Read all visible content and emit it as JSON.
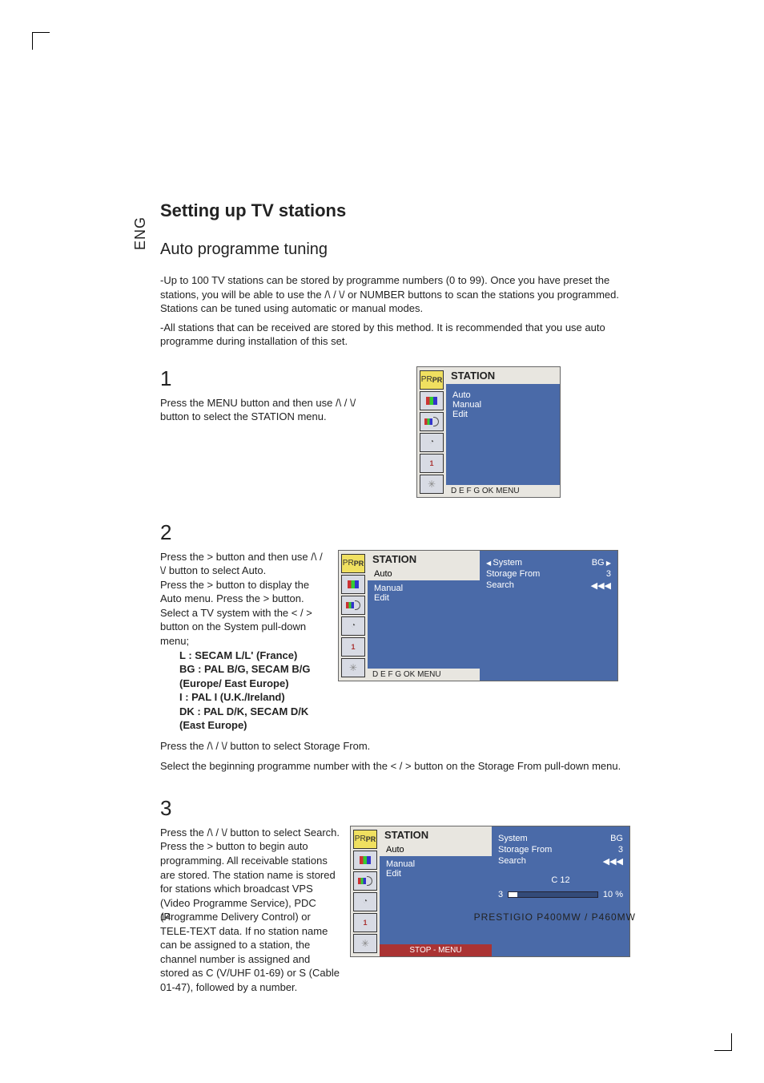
{
  "side_tab": "ENG",
  "title": "Setting up TV stations",
  "subtitle": "Auto programme tuning",
  "intro_line1": "-Up to 100 TV stations can be stored by programme numbers (0 to 99). Once you have preset the stations, you will be able to use the /\\ / \\/ or NUMBER buttons to scan the stations you programmed. Stations can be tuned using automatic or manual modes.",
  "intro_line2": "-All stations that can be received are stored by this method. It is recommended that you use auto programme during installation of this set.",
  "step1": {
    "num": "1",
    "text": "Press the MENU button and then use /\\ / \\/ button to select the STATION menu."
  },
  "step2": {
    "num": "2",
    "p1": "Press the > button and then use /\\ / \\/ button to select Auto.",
    "p2": "Press the > button to display the Auto menu. Press the > button. Select a TV system with the < / > button on the System pull-down menu;",
    "opt_l": "L : SECAM L/L' (France)",
    "opt_bg": "BG : PAL B/G, SECAM B/G (Europe/ East Europe)",
    "opt_i": "I : PAL I (U.K./Ireland)",
    "opt_dk": "DK : PAL D/K, SECAM D/K (East Europe)",
    "after1": "Press the /\\ / \\/ button to select Storage From.",
    "after2": "Select the beginning programme number with the < / > button on the Storage From pull-down menu."
  },
  "step3": {
    "num": "3",
    "text": "Press the /\\ / \\/ button to select Search. Press the > button to begin auto programming. All receivable stations are stored. The station name is stored for stations which broadcast VPS (Video Programme Service), PDC (Programme Delivery Control) or TELE-TEXT data. If no station name can be assigned to a station, the channel number is assigned and stored as C (V/UHF 01-69) or S (Cable 01-47), followed by a number."
  },
  "osd": {
    "title": "STATION",
    "items": {
      "auto": "Auto",
      "manual": "Manual",
      "edit": "Edit"
    },
    "foot_nav": "D  E  F  G   OK  MENU",
    "pane2": {
      "system_label": "System",
      "system_val": "BG",
      "storage_label": "Storage From",
      "storage_val": "3",
      "search_label": "Search",
      "search_val": "◀◀◀"
    },
    "pane3": {
      "channel": "C 12",
      "prog_left": "3",
      "prog_right": "10 %",
      "stop": "STOP - MENU"
    },
    "pr": "PR"
  },
  "footer": {
    "page": "14",
    "model": "PRESTIGIO P400MW / P460MW"
  }
}
